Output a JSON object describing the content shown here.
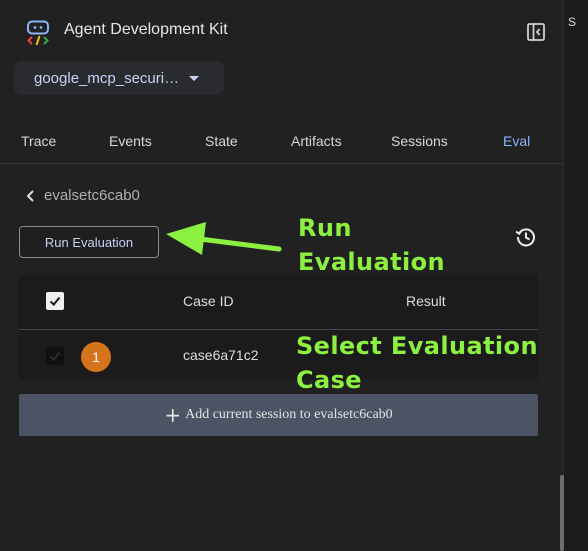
{
  "header": {
    "title": "Agent Development Kit",
    "logo_icon": "adk-logo-icon",
    "collapse_icon": "panel-collapse-icon"
  },
  "app_select": {
    "value": "google_mcp_securi…"
  },
  "tabs": [
    {
      "label": "Trace"
    },
    {
      "label": "Events"
    },
    {
      "label": "State"
    },
    {
      "label": "Artifacts"
    },
    {
      "label": "Sessions"
    },
    {
      "label": "Eval",
      "active": true
    }
  ],
  "right_panel": {
    "partial_text": "S"
  },
  "eval": {
    "evalset_name": "evalsetc6cab0",
    "run_button": "Run Evaluation",
    "history_icon": "history-icon",
    "table": {
      "headers": [
        "Case ID",
        "Result"
      ],
      "rows": [
        {
          "badge": "1",
          "case_id": "case6a71c2",
          "result": "",
          "checked": true
        }
      ]
    },
    "add_session_button": "Add current session to evalsetc6cab0"
  },
  "annotations": {
    "run_line1": "Run",
    "run_line2": "Evaluation",
    "select_line1": "Select Evaluation",
    "select_line2": "Case"
  },
  "colors": {
    "background": "#212121",
    "accent": "#8ab4f8",
    "annotation": "#8cf040",
    "badge": "#d4731c",
    "add_button": "#4b5365"
  }
}
